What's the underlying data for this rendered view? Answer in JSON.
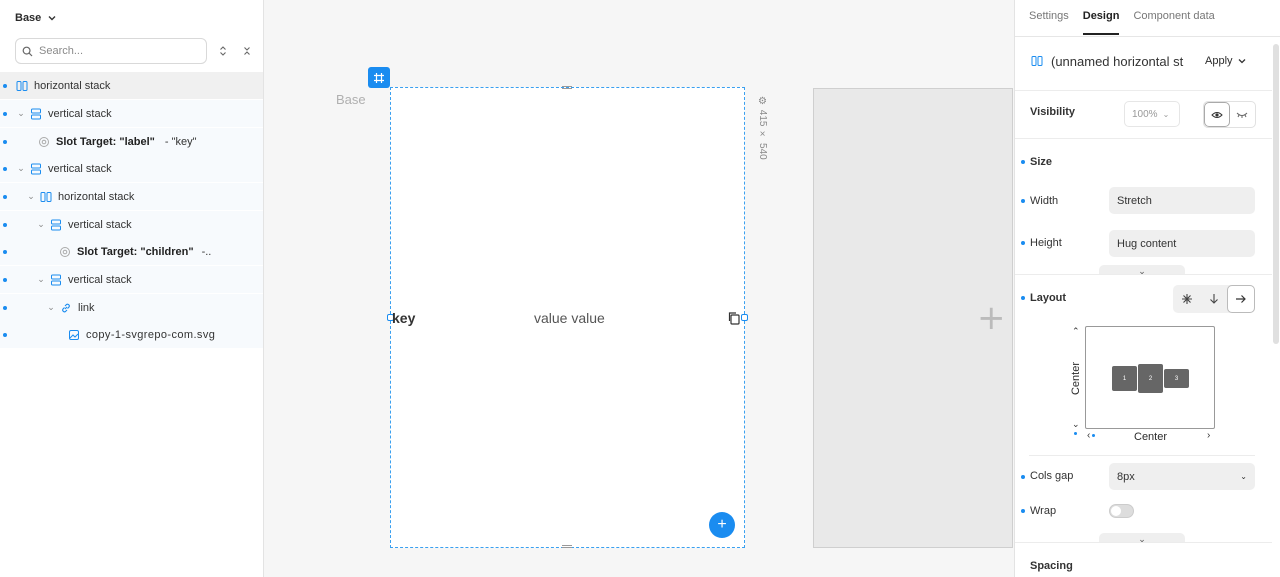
{
  "left_panel": {
    "base_label": "Base",
    "search_placeholder": "Search...",
    "tree": [
      {
        "label": "horizontal stack",
        "icon": "hstack-icon",
        "selected": true
      },
      {
        "label": "vertical stack",
        "icon": "vstack-icon"
      },
      {
        "slot_label": "Slot Target: \"label\"",
        "slot_value": "- \"key\"",
        "icon": "slot-icon"
      },
      {
        "label": "vertical stack",
        "icon": "vstack-icon"
      },
      {
        "label": "horizontal stack",
        "icon": "hstack-icon"
      },
      {
        "label": "vertical stack",
        "icon": "vstack-icon"
      },
      {
        "slot_label": "Slot Target: \"children\"",
        "slot_value": "-..",
        "icon": "slot-icon"
      },
      {
        "label": "vertical stack",
        "icon": "vstack-icon"
      },
      {
        "label": "link",
        "icon": "link-icon"
      },
      {
        "label": "copy-1-svgrepo-com.svg",
        "icon": "image-icon"
      }
    ]
  },
  "canvas": {
    "base_label": "Base",
    "dimensions": "415 × 540",
    "key_text": "key",
    "value_text": "value value"
  },
  "right_panel": {
    "tabs": [
      "Settings",
      "Design",
      "Component data"
    ],
    "component_name": "(unnamed horizontal st",
    "apply_label": "Apply",
    "visibility": {
      "label": "Visibility",
      "opacity": "100%"
    },
    "size": {
      "label": "Size",
      "width_label": "Width",
      "width_value": "Stretch",
      "height_label": "Height",
      "height_value": "Hug content"
    },
    "layout": {
      "label": "Layout",
      "vertical_align": "Center",
      "horizontal_align": "Center",
      "items": [
        "1",
        "2",
        "3"
      ]
    },
    "cols_gap": {
      "label": "Cols gap",
      "value": "8px"
    },
    "wrap": {
      "label": "Wrap"
    },
    "spacing": {
      "label": "Spacing"
    }
  },
  "colors": {
    "accent": "#1a8cf0",
    "panel_bg": "#ffffff",
    "canvas_bg": "#f6f6f6"
  }
}
